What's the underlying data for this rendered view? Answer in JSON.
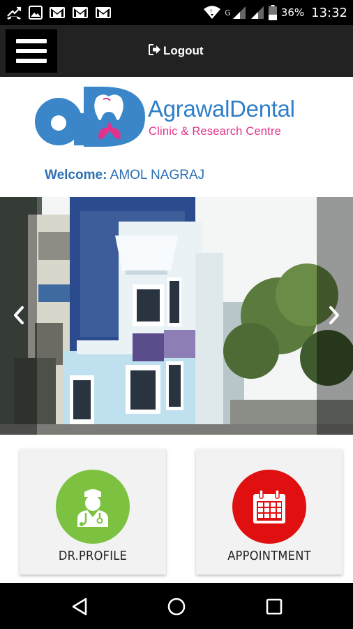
{
  "status_bar": {
    "network_type": "G",
    "battery_percent": "36%",
    "time": "13:32",
    "icons": [
      "missed-call-icon",
      "image-icon",
      "gmail-icon",
      "gmail-icon",
      "gmail-icon",
      "wifi-icon",
      "signal-icon",
      "signal-icon",
      "battery-icon"
    ]
  },
  "header": {
    "menu_icon": "hamburger-menu-icon",
    "logout_icon": "logout-icon",
    "logout_label": "Logout",
    "background": "#222222"
  },
  "logo": {
    "brand_name": "AgrawalDental",
    "brand_sub": "Clinic & Research Centre",
    "brand_color": "#2f7fc8",
    "sub_color": "#e2338c"
  },
  "welcome": {
    "label": "Welcome:",
    "user_name": "AMOL NAGRAJ"
  },
  "carousel": {
    "prev_icon": "chevron-left-icon",
    "next_icon": "chevron-right-icon"
  },
  "tiles": [
    {
      "label": "DR.PROFILE",
      "icon": "doctor-icon",
      "color": "#7cc240"
    },
    {
      "label": "APPOINTMENT",
      "icon": "calendar-icon",
      "color": "#e01010"
    }
  ],
  "nav_bar": {
    "icons": [
      "back-icon",
      "home-icon",
      "recent-apps-icon"
    ]
  }
}
